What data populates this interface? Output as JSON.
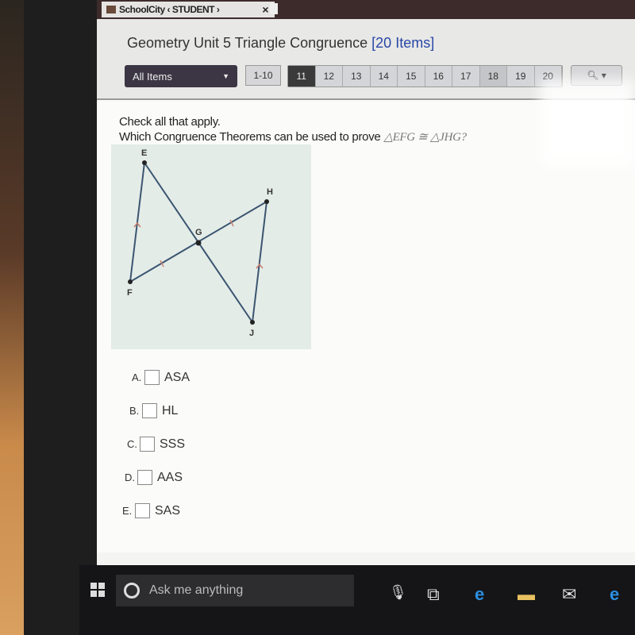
{
  "browser": {
    "tab_title": "SchoolCity ‹ STUDENT ›",
    "close": "×"
  },
  "header": {
    "title": "Geometry Unit 5 Triangle Congruence",
    "item_count": "[20 Items]"
  },
  "toolbar": {
    "filter": "All Items",
    "range": "1-10",
    "pages": [
      "11",
      "12",
      "13",
      "14",
      "15",
      "16",
      "17",
      "18",
      "19",
      "20"
    ],
    "active_page": "11",
    "search_caret": "▾"
  },
  "question": {
    "instruction": "Check all that apply.",
    "prompt": "Which Congruence Theorems can be used to prove",
    "expression": "△EFG ≅ △JHG?",
    "diagram": {
      "points": [
        "E",
        "F",
        "G",
        "H",
        "J"
      ]
    },
    "options": [
      {
        "letter": "A.",
        "label": "ASA",
        "checked": false
      },
      {
        "letter": "B.",
        "label": "HL",
        "checked": false
      },
      {
        "letter": "C.",
        "label": "SSS",
        "checked": false
      },
      {
        "letter": "D.",
        "label": "AAS",
        "checked": false
      },
      {
        "letter": "E.",
        "label": "SAS",
        "checked": false
      }
    ]
  },
  "taskbar": {
    "search_placeholder": "Ask me anything"
  }
}
